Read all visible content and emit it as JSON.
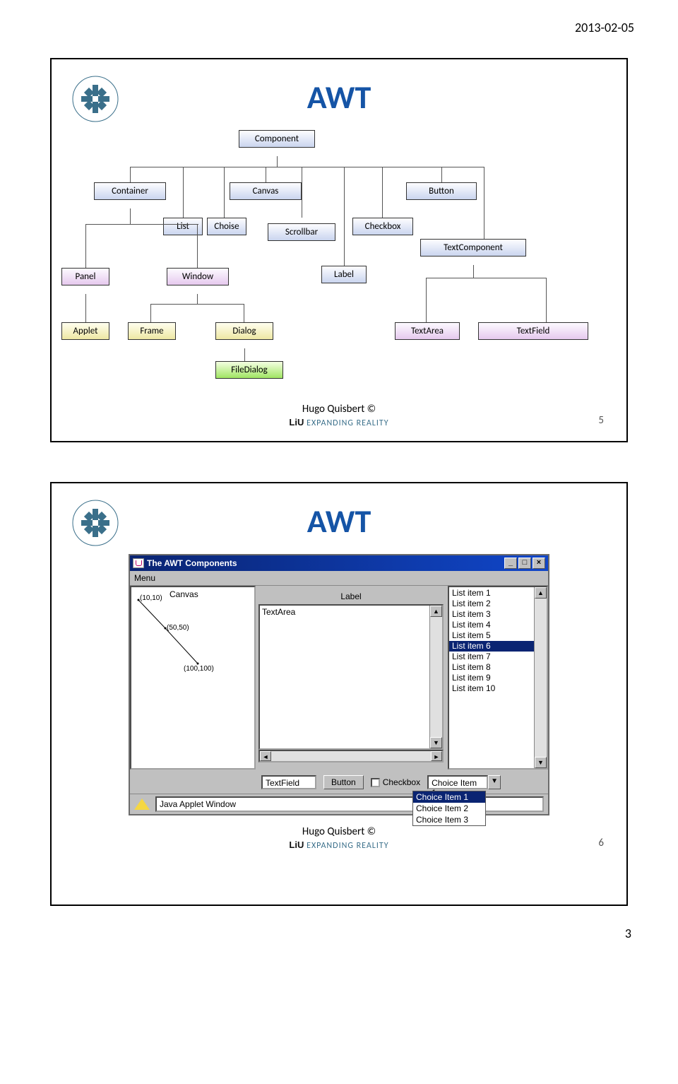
{
  "headerDate": "2013-02-05",
  "pageNumber": "3",
  "slide1": {
    "title": "AWT",
    "nodes": {
      "component": "Component",
      "container": "Container",
      "canvas": "Canvas",
      "button": "Button",
      "list": "List",
      "choise": "Choise",
      "scrollbar": "Scrollbar",
      "checkbox": "Checkbox",
      "textcomponent": "TextComponent",
      "label": "Label",
      "panel": "Panel",
      "window": "Window",
      "applet": "Applet",
      "frame": "Frame",
      "dialog": "Dialog",
      "textarea": "TextArea",
      "textfield": "TextField",
      "filedialog": "FileDialog"
    },
    "author": "Hugo Quisbert ©",
    "tag": "LiU EXPANDING REALITY",
    "number": "5"
  },
  "slide2": {
    "title": "AWT",
    "win": {
      "title": "The AWT Components",
      "menu": "Menu",
      "canvasLabel": "Canvas",
      "points": {
        "p1": "(10,10)",
        "p2": "(50,50)",
        "p3": "(100,100)"
      },
      "midLabel": "Label",
      "textareaContent": "TextArea",
      "listItems": [
        "List item 1",
        "List item 2",
        "List item 3",
        "List item 4",
        "List item 5",
        "List item 6",
        "List item 7",
        "List item 8",
        "List item 9",
        "List item 10"
      ],
      "listSelectedIndex": 5,
      "textfield": "TextField",
      "button": "Button",
      "checkbox": "Checkbox",
      "choiceSelected": "Choice Item 1",
      "choiceOptions": [
        "Choice Item 1",
        "Choice Item 2",
        "Choice Item 3"
      ],
      "status": "Java Applet Window"
    },
    "author": "Hugo Quisbert ©",
    "tag": "LiU EXPANDING REALITY",
    "number": "6"
  }
}
